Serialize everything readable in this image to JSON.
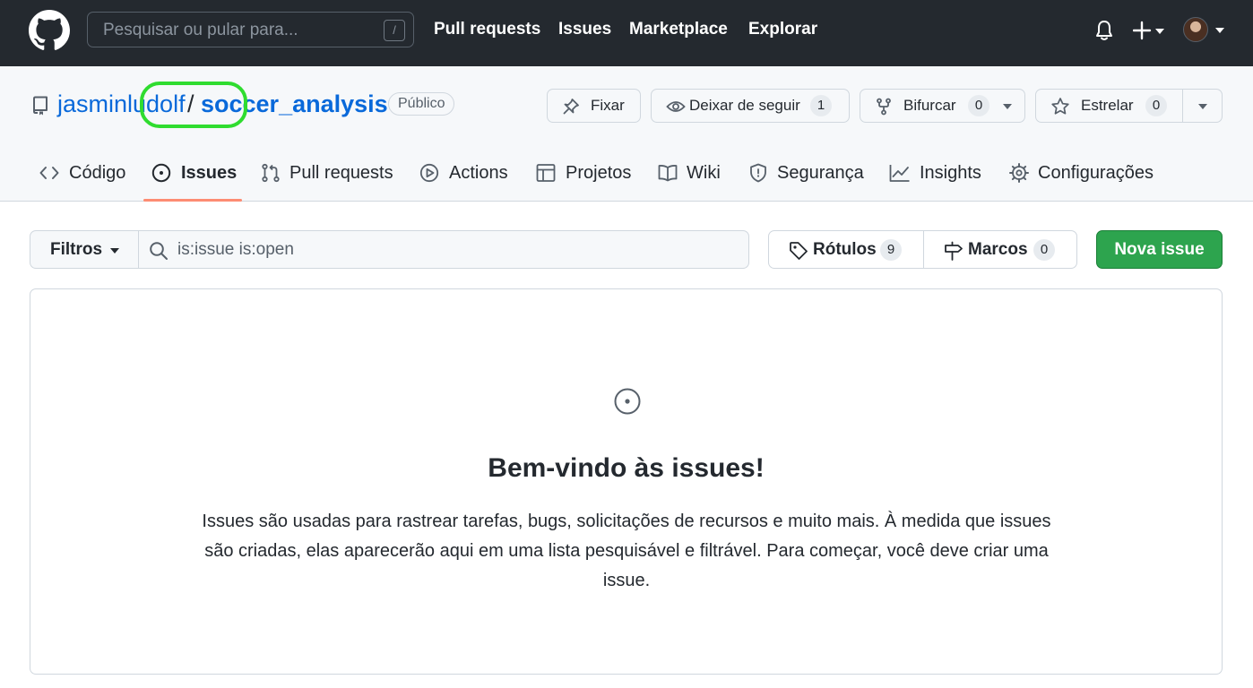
{
  "header": {
    "search_placeholder": "Pesquisar ou pular para...",
    "search_shortcut": "/",
    "nav": [
      "Pull requests",
      "Issues",
      "Marketplace",
      "Explorar"
    ]
  },
  "repo": {
    "owner": "jasminludolf",
    "separator": "/",
    "name": "soccer_analysis",
    "visibility": "Público",
    "actions": {
      "pin_label": "Fixar",
      "unwatch_label": "Deixar de seguir",
      "watch_count": "1",
      "fork_label": "Bifurcar",
      "fork_count": "0",
      "star_label": "Estrelar",
      "star_count": "0"
    }
  },
  "tabs": [
    {
      "label": "Código",
      "icon": "code-icon"
    },
    {
      "label": "Issues",
      "icon": "issue-opened-icon",
      "selected": true
    },
    {
      "label": "Pull requests",
      "icon": "git-pull-request-icon"
    },
    {
      "label": "Actions",
      "icon": "play-icon"
    },
    {
      "label": "Projetos",
      "icon": "table-icon"
    },
    {
      "label": "Wiki",
      "icon": "book-icon"
    },
    {
      "label": "Segurança",
      "icon": "shield-icon"
    },
    {
      "label": "Insights",
      "icon": "graph-icon"
    },
    {
      "label": "Configurações",
      "icon": "gear-icon"
    }
  ],
  "toolbar": {
    "filters_label": "Filtros",
    "filter_value": "is:issue is:open",
    "labels_label": "Rótulos",
    "labels_count": "9",
    "milestones_label": "Marcos",
    "milestones_count": "0",
    "new_issue_label": "Nova issue"
  },
  "blankslate": {
    "title": "Bem-vindo às issues!",
    "description": "Issues são usadas para rastrear tarefas, bugs, solicitações de recursos e muito mais. À medida que issues são criadas, elas aparecerão aqui em uma lista pesquisável e filtrável. Para começar, você deve criar uma issue."
  },
  "colors": {
    "header_bg": "#24292f",
    "link": "#0969da",
    "primary_button": "#2da44e",
    "selected_tab_underline": "#fd8c73",
    "highlight_ring": "#2fdc2f"
  }
}
